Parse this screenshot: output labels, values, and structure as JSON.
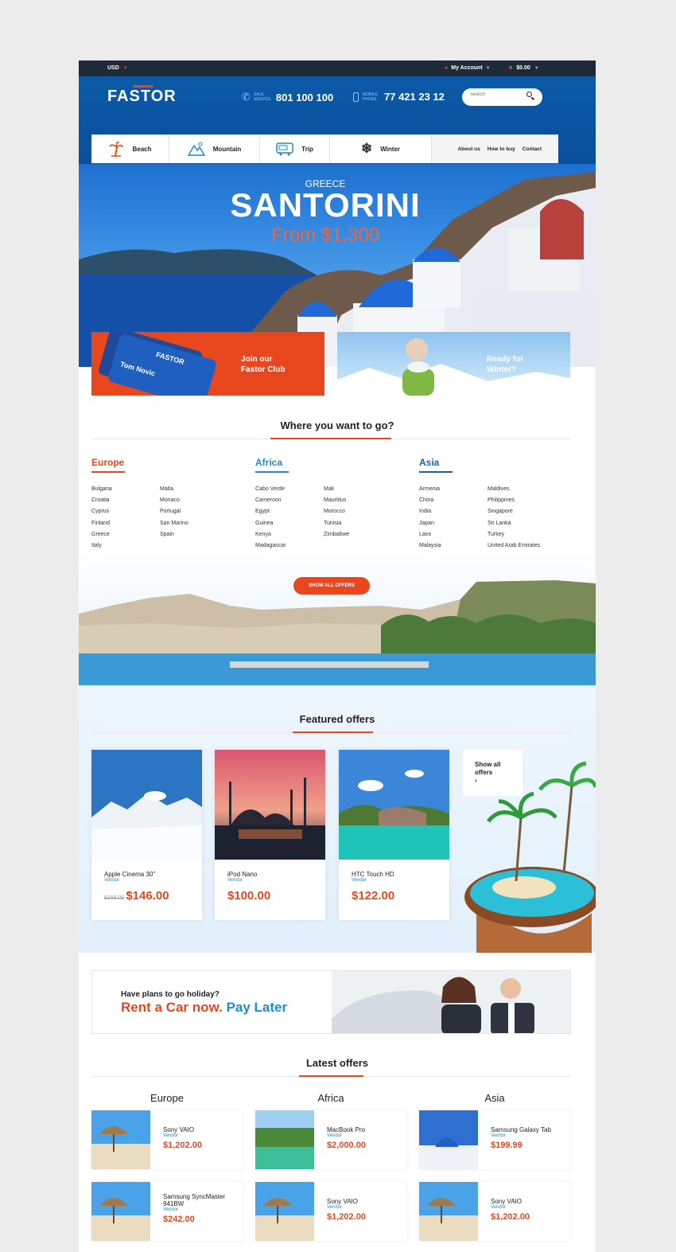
{
  "topbar": {
    "currency": "USD",
    "account": "My Account",
    "cart": "$0.00"
  },
  "header": {
    "logo": "FASTOR",
    "sales_label_1": "SALE",
    "sales_label_2": "SERVICE",
    "sales_phone": "801 100 100",
    "mobile_label_1": "MOBILE",
    "mobile_label_2": "PHONE",
    "mobile_phone": "77 421 23 12",
    "search_placeholder": "Search"
  },
  "nav": {
    "items": [
      {
        "label": "Beach",
        "icon": "palm-tree-icon"
      },
      {
        "label": "Mountain",
        "icon": "mountain-icon"
      },
      {
        "label": "Trip",
        "icon": "bus-icon"
      },
      {
        "label": "Winter",
        "icon": "snowflake-icon"
      }
    ],
    "links": [
      "About us",
      "How to buy",
      "Contact"
    ]
  },
  "hero": {
    "subtitle": "GREECE",
    "title": "SANTORINI",
    "price": "From $1,300"
  },
  "promos": {
    "club": {
      "line1": "Join our",
      "line2": "Fastor Club",
      "card_brand": "FASTOR",
      "card_name": "Tom Novic"
    },
    "winter": {
      "line1": "Ready for",
      "line2": "Winter?"
    }
  },
  "destinations": {
    "title": "Where you want to go?",
    "regions": [
      {
        "name": "Europe",
        "color": "#e8461d",
        "col1": [
          "Bulgaria",
          "Croatia",
          "Cyprus",
          "Finland",
          "Greece",
          "Italy"
        ],
        "col2": [
          "Malta",
          "Monaco",
          "Portugal",
          "San Marino",
          "Spain"
        ]
      },
      {
        "name": "Africa",
        "color": "#1f8ad6",
        "col1": [
          "Cabo Verde",
          "Cameroon",
          "Egypt",
          "Guinea",
          "Kenya",
          "Madagascar"
        ],
        "col2": [
          "Mali",
          "Mauritius",
          "Morocco",
          "Tunisia",
          "Zimbabwe"
        ]
      },
      {
        "name": "Asia",
        "color": "#1a5fa8",
        "col1": [
          "Armenia",
          "China",
          "India",
          "Japan",
          "Laos",
          "Malaysia"
        ],
        "col2": [
          "Maldives",
          "Philippines",
          "Singapore",
          "Sri Lanka",
          "Turkey",
          "United Arab Emirates"
        ]
      }
    ],
    "button": "SHOW ALL OFFERS"
  },
  "featured": {
    "title": "Featured offers",
    "cards": [
      {
        "name": "Apple Cinema 30\"",
        "vendor": "Vendor",
        "old_price": "$158.00",
        "price": "$146.00"
      },
      {
        "name": "iPod Nano",
        "vendor": "Vendor",
        "old_price": "",
        "price": "$100.00"
      },
      {
        "name": "HTC Touch HD",
        "vendor": "Vendor",
        "old_price": "",
        "price": "$122.00"
      }
    ],
    "show_all_1": "Show all",
    "show_all_2": "offers",
    "show_all_arrow": "›"
  },
  "car": {
    "question": "Have plans to go holiday?",
    "rent": "Rent a Car now.",
    "pay": "Pay Later"
  },
  "latest": {
    "title": "Latest offers",
    "columns": [
      {
        "region": "Europe",
        "items": [
          {
            "name": "Sony VAIO",
            "vendor": "Vendor",
            "price": "$1,202.00"
          },
          {
            "name": "Samsung SyncMaster 941BW",
            "vendor": "Vendor",
            "price": "$242.00"
          }
        ]
      },
      {
        "region": "Africa",
        "items": [
          {
            "name": "MacBook Pro",
            "vendor": "Vendor",
            "price": "$2,000.00"
          },
          {
            "name": "Sony VAIO",
            "vendor": "Vendor",
            "price": "$1,202.00"
          }
        ]
      },
      {
        "region": "Asia",
        "items": [
          {
            "name": "Samsung Galaxy Tab",
            "vendor": "Vendor",
            "price": "$199.99"
          },
          {
            "name": "Sony VAIO",
            "vendor": "Vendor",
            "price": "$1,202.00"
          }
        ]
      }
    ]
  },
  "colors": {
    "accent": "#e8461d",
    "blue": "#1f8ad6",
    "header": "#0b5aa8"
  }
}
